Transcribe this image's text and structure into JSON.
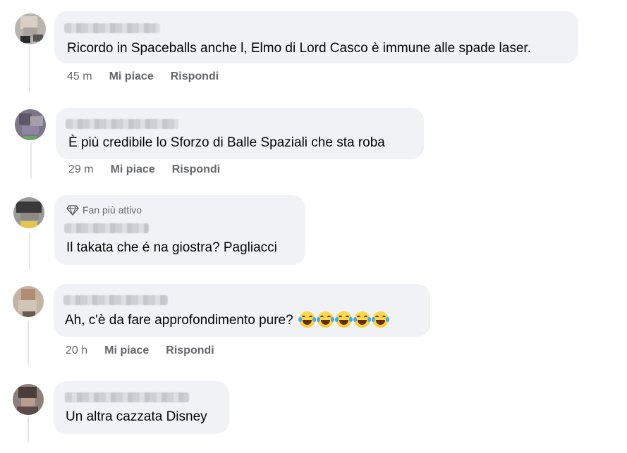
{
  "comments": [
    {
      "text": "Ricordo in Spaceballs anche l, Elmo di Lord Casco è immune alle spade laser.",
      "time": "45 m",
      "like": "Mi piace",
      "reply": "Rispondi"
    },
    {
      "text": "È più credibile lo Sforzo di Balle Spaziali che sta roba",
      "time": "29 m",
      "like": "Mi piace",
      "reply": "Rispondi"
    },
    {
      "badge": "Fan più attivo",
      "text": "Il takata che é na giostra? Pagliacci"
    },
    {
      "text": "Ah, c'è da fare approfondimento pure?",
      "emoji": [
        "rofl-emoji",
        "rofl-emoji",
        "rofl-emoji",
        "rofl-emoji",
        "rofl-emoji"
      ],
      "time": "20 h",
      "like": "Mi piace",
      "reply": "Rispondi"
    },
    {
      "text": "Un altra cazzata Disney"
    }
  ],
  "colors": {
    "bubble": "#f0f2f5",
    "secondary_text": "#65676b",
    "thread_line": "#e4e6eb"
  }
}
